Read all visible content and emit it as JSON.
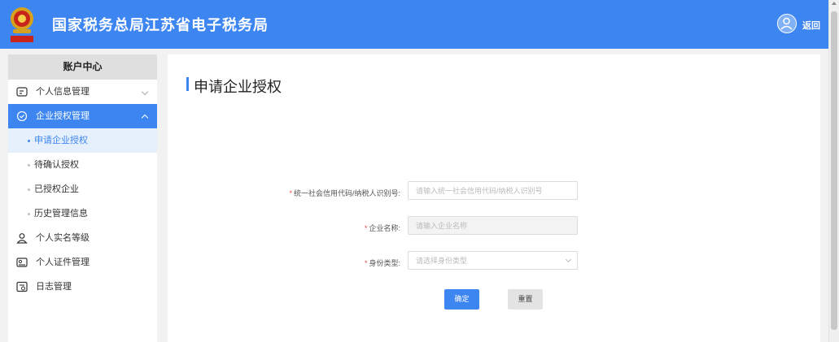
{
  "header": {
    "title": "国家税务总局江苏省电子税务局",
    "back_label": "返回"
  },
  "sidebar": {
    "heading": "账户中心",
    "menu": [
      {
        "label": "个人信息管理",
        "icon": "id-card-icon"
      },
      {
        "label": "企业授权管理",
        "icon": "shield-check-icon"
      },
      {
        "label": "个人实名等级",
        "icon": "user-level-icon"
      },
      {
        "label": "个人证件管理",
        "icon": "certificate-icon"
      },
      {
        "label": "日志管理",
        "icon": "log-icon"
      }
    ],
    "submenu": [
      {
        "label": "申请企业授权"
      },
      {
        "label": "待确认授权"
      },
      {
        "label": "已授权企业"
      },
      {
        "label": "历史管理信息"
      }
    ]
  },
  "main": {
    "title": "申请企业授权",
    "form": {
      "credit_code_label": "统一社会信用代码/纳税人识别号:",
      "credit_code_placeholder": "请输入统一社会信用代码/纳税人识别号",
      "company_name_label": "企业名称:",
      "company_name_placeholder": "请输入企业名称",
      "identity_type_label": "身份类型:",
      "identity_type_placeholder": "请选择身份类型",
      "required_mark": "*"
    },
    "buttons": {
      "confirm": "确定",
      "reset": "重置"
    }
  },
  "colors": {
    "primary": "#3d86f2",
    "required": "#e34d4d"
  }
}
